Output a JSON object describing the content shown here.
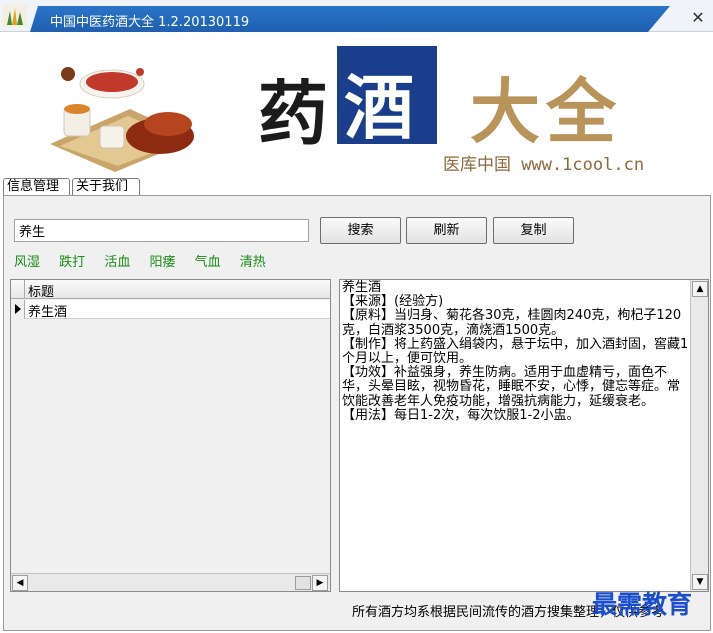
{
  "window": {
    "title": "中国中医药酒大全 1.2.20130119",
    "close_glyph": "✕"
  },
  "banner": {
    "char1": "药",
    "char2": "酒",
    "char3": "大全",
    "site": "医库中国 www.1cool.cn"
  },
  "tabs": [
    {
      "label": "信息管理"
    },
    {
      "label": "关于我们"
    }
  ],
  "search": {
    "value": "养生"
  },
  "buttons": {
    "search": "搜索",
    "refresh": "刷新",
    "copy": "复制"
  },
  "quick_tags": [
    "风湿",
    "跌打",
    "活血",
    "阳痿",
    "气血",
    "清热"
  ],
  "grid": {
    "column_header": "标题",
    "rows": [
      {
        "title": "养生酒"
      }
    ]
  },
  "detail": {
    "lines": [
      "养生酒",
      "【来源】(经验方)",
      "【原料】当归身、菊花各30克，桂圆肉240克，枸杞子120克，白酒浆3500克，滴烧酒1500克。",
      "【制作】将上药盛入绢袋内，悬于坛中，加入酒封固，窖藏1个月以上，便可饮用。",
      "【功效】补益强身，养生防病。适用于血虚精亏，面色不华，头晕目眩，视物昏花，睡眠不安，心悸，健忘等症。常饮能改善老年人免疫功能，增强抗病能力，延缓衰老。",
      "【用法】每日1-2次，每次饮服1-2小盅。"
    ]
  },
  "footer_note": "所有酒方均系根据民间流传的酒方搜集整理，仅供参考",
  "watermark": "最需教育",
  "colors": {
    "titlebar": "#1f5fae",
    "banner_box": "#1a3e8c",
    "banner_gold": "#b8945a",
    "tag_green": "#1a8a1a",
    "watermark_blue": "#1a4ecf"
  }
}
